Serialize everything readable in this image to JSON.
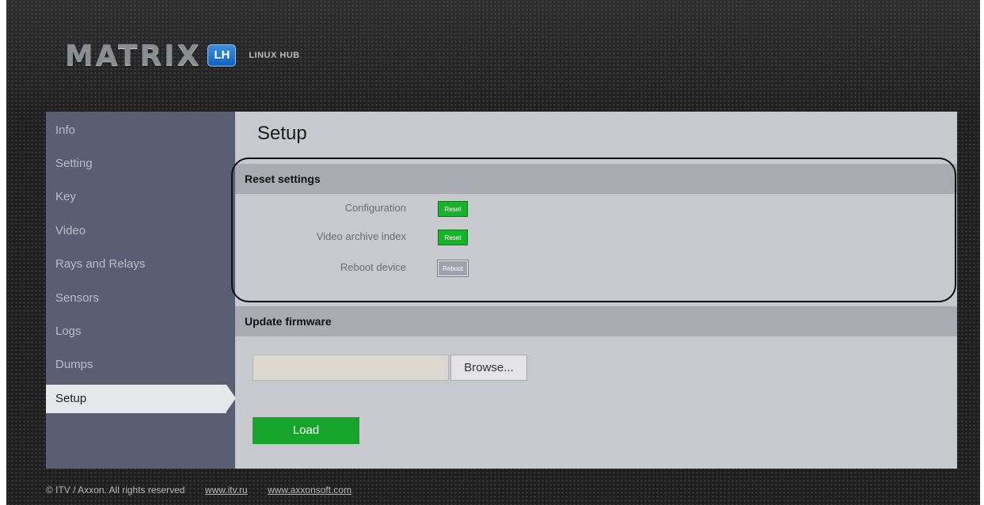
{
  "header": {
    "logo_text": "MATRIX",
    "logo_badge": "LH",
    "logo_subtitle": "LINUX HUB"
  },
  "sidebar": {
    "items": [
      {
        "label": "Info"
      },
      {
        "label": "Setting"
      },
      {
        "label": "Key"
      },
      {
        "label": "Video"
      },
      {
        "label": "Rays and Relays"
      },
      {
        "label": "Sensors"
      },
      {
        "label": "Logs"
      },
      {
        "label": "Dumps"
      },
      {
        "label": "Setup",
        "active": true
      }
    ]
  },
  "main": {
    "title": "Setup",
    "reset_section": {
      "title": "Reset settings",
      "rows": [
        {
          "label": "Configuration",
          "button": "Reset"
        },
        {
          "label": "Video archive index",
          "button": "Reset"
        },
        {
          "label": "Reboot device",
          "button": "Reboot"
        }
      ]
    },
    "firmware_section": {
      "title": "Update firmware",
      "file_value": "",
      "browse_label": "Browse...",
      "load_label": "Load"
    }
  },
  "footer": {
    "copyright": "© ITV / Axxon. All rights reserved",
    "link1": "www.itv.ru",
    "link2": "www.axxonsoft.com"
  },
  "colors": {
    "sidebar_bg": "#5a5e72",
    "content_bg": "#c8c9cf",
    "section_bar": "#a9abb3",
    "accent_green": "#16a52a",
    "badge_blue": "#1f74d0"
  }
}
